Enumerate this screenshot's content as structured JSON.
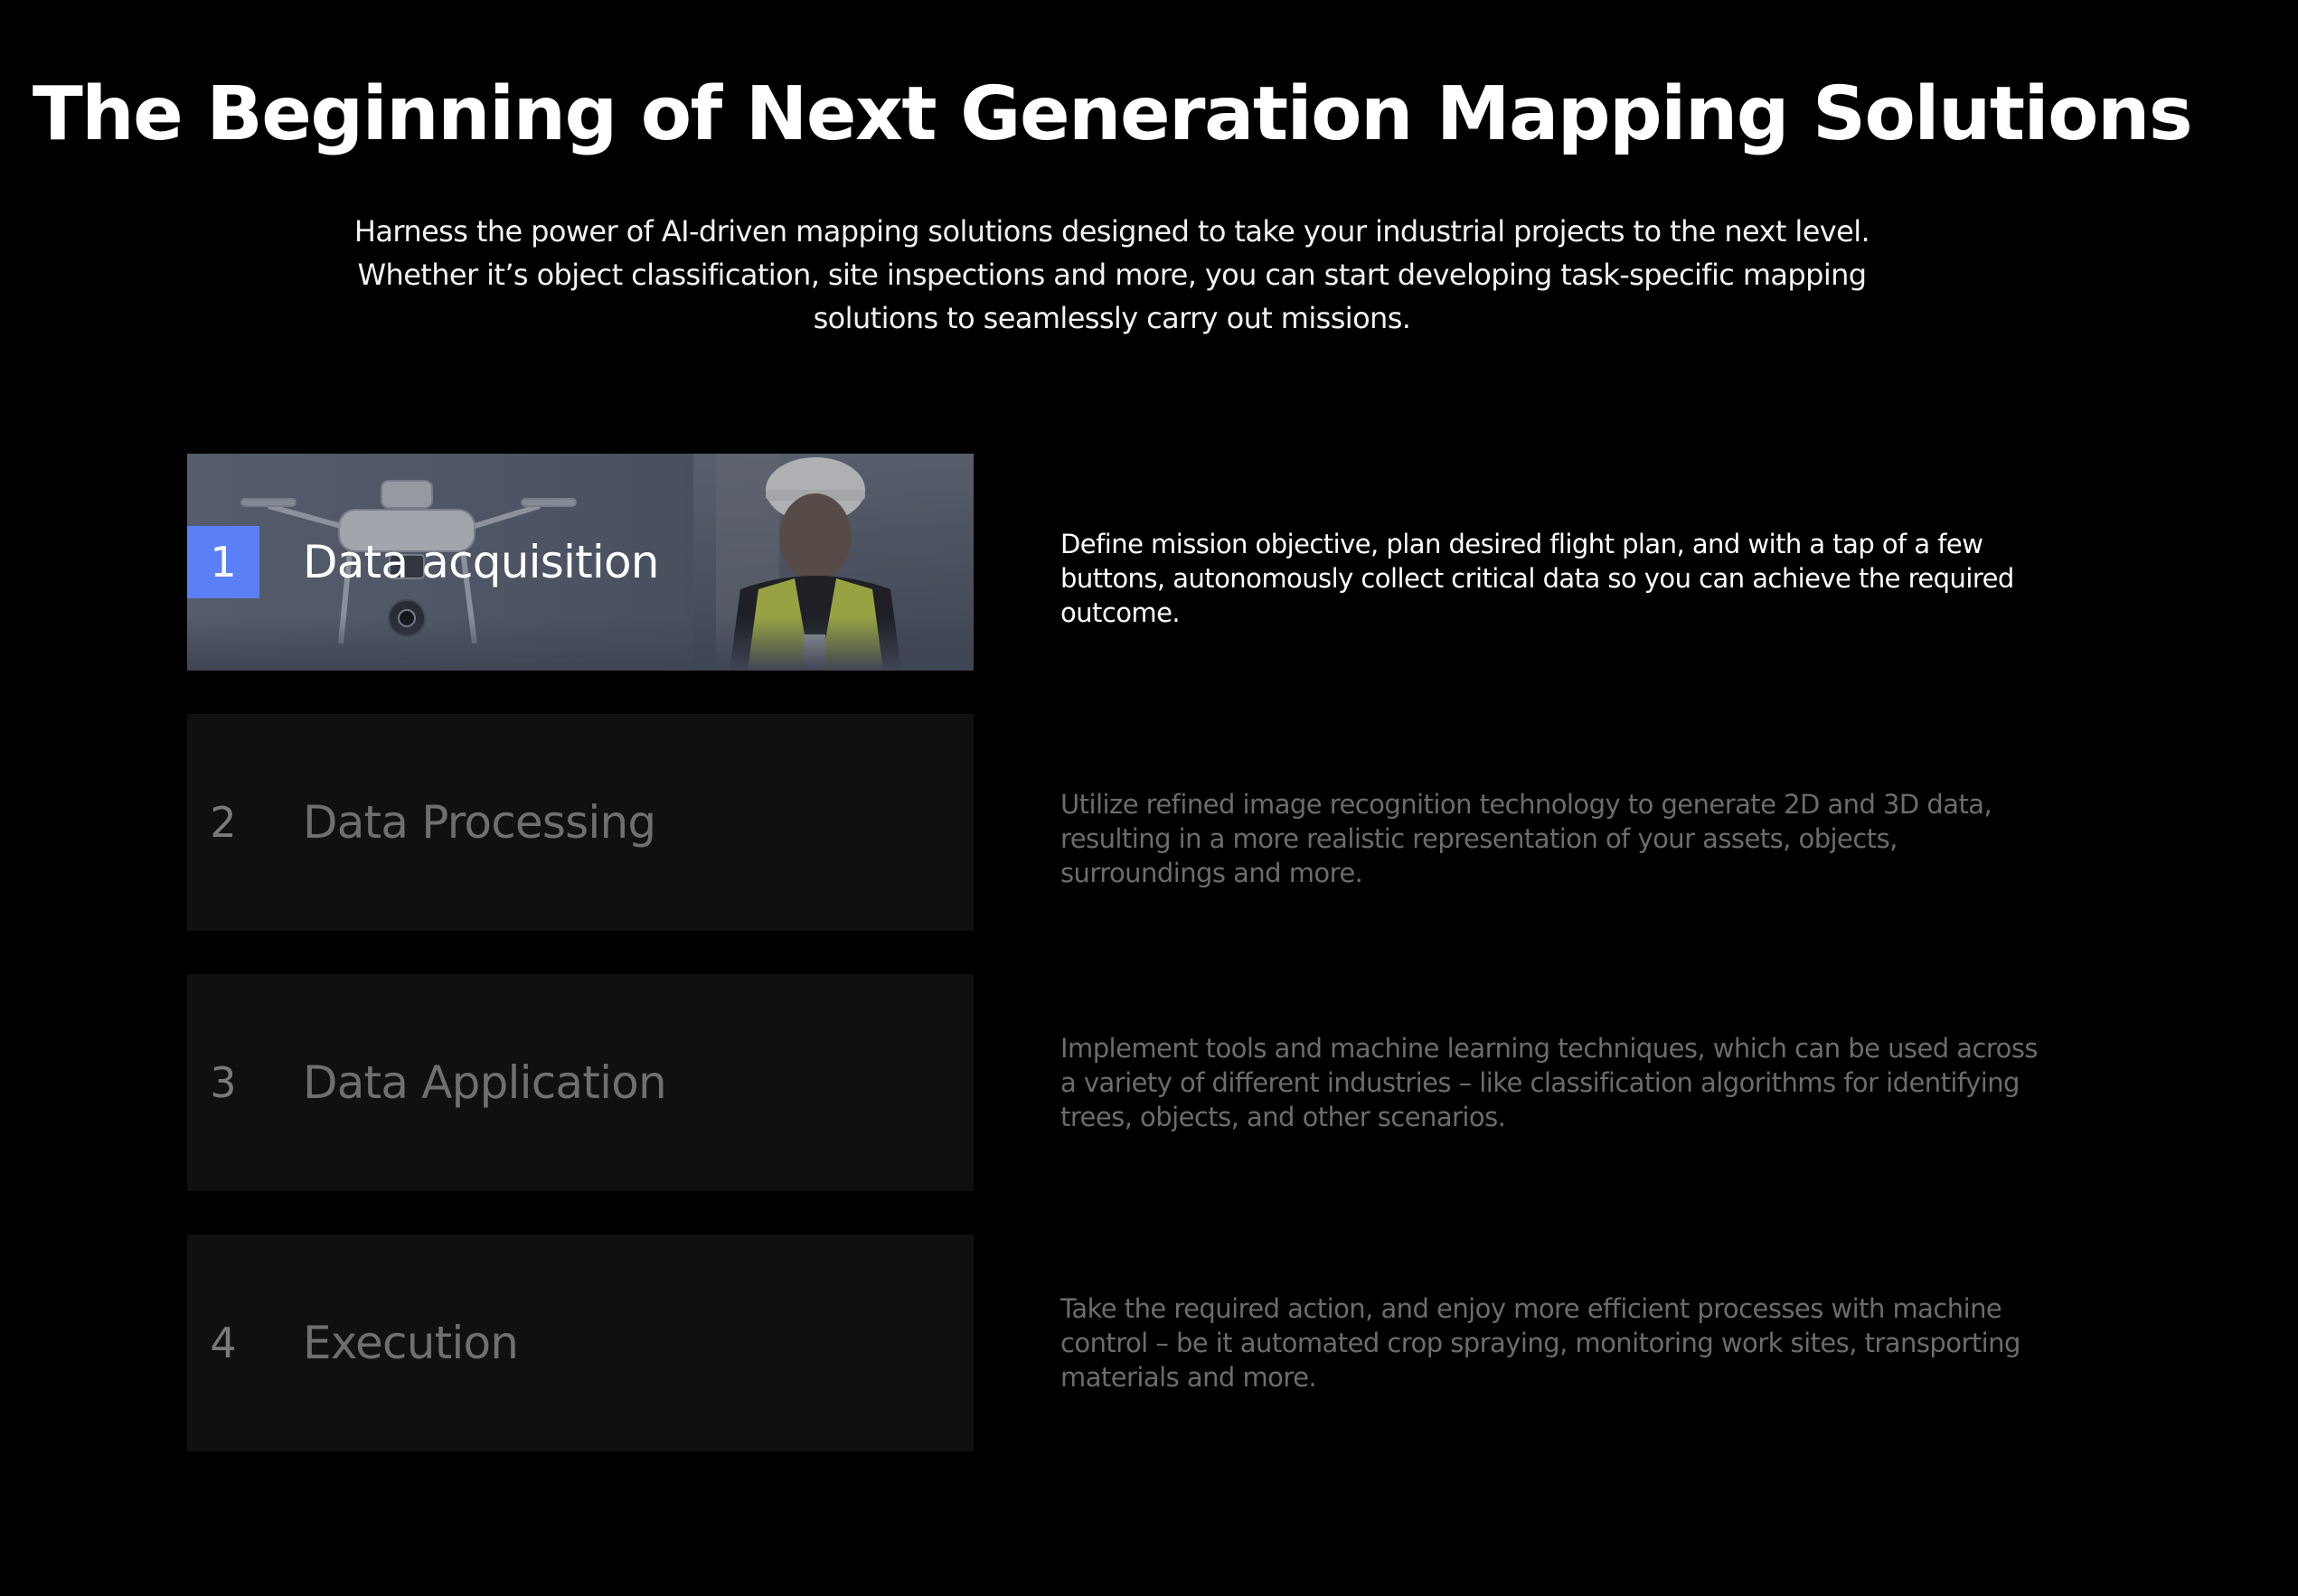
{
  "page": {
    "title": "The Beginning of Next Generation Mapping Solutions",
    "intro": "Harness the power of AI-driven mapping solutions designed to take your industrial projects to the next level. Whether it’s object classification, site inspections and more, you can start developing task-specific mapping solutions to seamlessly carry out missions."
  },
  "colors": {
    "background": "#000000",
    "active_badge": "#5b7ff6",
    "inactive_card": "#101010",
    "inactive_text": "#6f6f6f",
    "active_text": "#ffffff"
  },
  "steps": [
    {
      "number": "1",
      "label": "Data acquisition",
      "description": "Define mission objective, plan desired flight plan, and with a tap of a few buttons, autonomously collect critical data so you can achieve the required outcome.",
      "active": true,
      "image": "drone-and-surveyor-photo"
    },
    {
      "number": "2",
      "label": "Data Processing",
      "description": "Utilize refined image recognition technology to generate 2D and 3D data, resulting in a more realistic representation of your assets, objects, surroundings and more.",
      "active": false
    },
    {
      "number": "3",
      "label": "Data Application",
      "description": "Implement tools and machine learning techniques, which can be used across a variety of different industries – like classification algorithms for identifying trees, objects, and other scenarios.",
      "active": false
    },
    {
      "number": "4",
      "label": "Execution",
      "description": "Take the required action, and enjoy more efficient processes with machine control – be it automated crop spraying, monitoring work sites, transporting materials and more.",
      "active": false
    }
  ]
}
